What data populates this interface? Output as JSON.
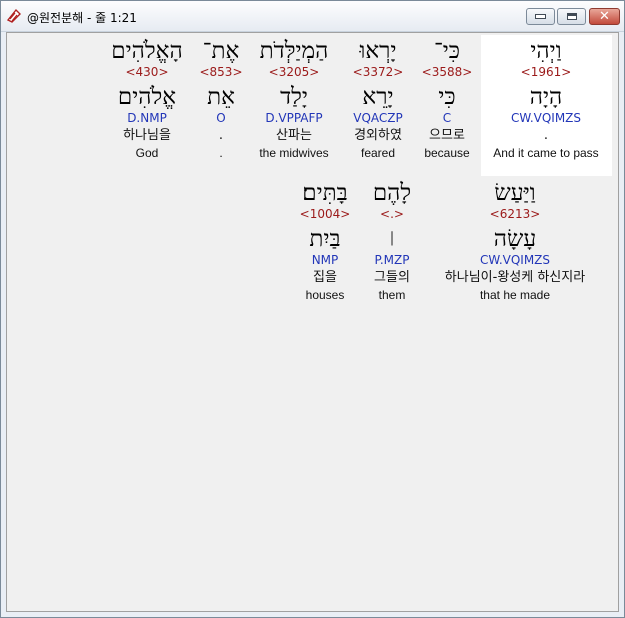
{
  "window": {
    "title": "@원전분해 - 줄 1:21",
    "min_label": "minimize",
    "max_label": "maximize",
    "close_glyph": "✕"
  },
  "rows": [
    {
      "words": [
        {
          "hebrew": "וַיְהִי",
          "strong": "<1961>",
          "lemma": "הָיָה",
          "morph": "CW.VQIMZS",
          "korean": ".",
          "english": "And it came to pass",
          "highlighted": true
        },
        {
          "hebrew": "כִּי־",
          "strong": "<3588>",
          "lemma": "כִּי",
          "morph": "C",
          "korean": "으므로",
          "english": "because"
        },
        {
          "hebrew": "יָרְאוּ",
          "strong": "<3372>",
          "lemma": "יָרֵא",
          "morph": "VQACZP",
          "korean": "경외하였",
          "english": "feared"
        },
        {
          "hebrew": "הַמְיַלְּדֹת",
          "strong": "<3205>",
          "lemma": "יָלַד",
          "morph": "D.VPPAFP",
          "korean": "산파는",
          "english": "the midwives"
        },
        {
          "hebrew": "אֶת־",
          "strong": "<853>",
          "lemma": "אֵת",
          "morph": "O",
          "korean": ".",
          "english": "."
        },
        {
          "hebrew": "הָאֱלֹהִים",
          "strong": "<430>",
          "lemma": "אֱלֹהִים",
          "morph": "D.NMP",
          "korean": "하나님을",
          "english": "God"
        }
      ]
    },
    {
      "words": [
        {
          "hebrew": "וַיַּעַשׂ",
          "strong": "<6213>",
          "lemma": "עָשָׂה",
          "morph": "CW.VQIMZS",
          "korean": "하나님이-왕성케 하신지라",
          "english": "that he made"
        },
        {
          "hebrew": "לָהֶם",
          "strong": "<.>",
          "lemma": "׀",
          "morph": "P.MZP",
          "korean": "그들의",
          "english": "them"
        },
        {
          "hebrew": "בָּתִּים׃",
          "strong": "<1004>",
          "lemma": "בַּיִת",
          "morph": "NMP",
          "korean": "집을",
          "english": "houses"
        }
      ]
    }
  ],
  "colors": {
    "strong": "#9b1a1a",
    "morph": "#2236b8",
    "highlight_bg": "#ffffff"
  }
}
